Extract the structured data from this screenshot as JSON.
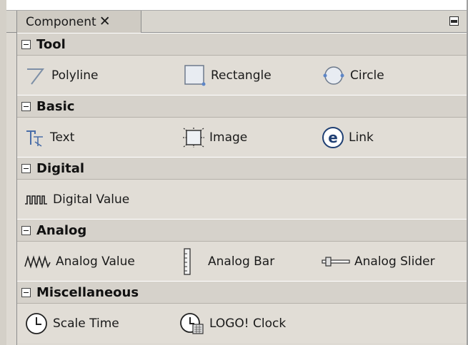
{
  "tab": {
    "label": "Component",
    "close_glyph": "✕"
  },
  "sections": [
    {
      "title": "Tool",
      "items": [
        {
          "label": "Polyline",
          "icon": "polyline-icon"
        },
        {
          "label": "Rectangle",
          "icon": "rectangle-icon"
        },
        {
          "label": "Circle",
          "icon": "circle-icon"
        }
      ]
    },
    {
      "title": "Basic",
      "items": [
        {
          "label": "Text",
          "icon": "text-icon"
        },
        {
          "label": "Image",
          "icon": "image-icon"
        },
        {
          "label": "Link",
          "icon": "link-icon",
          "icon_glyph": "e"
        }
      ]
    },
    {
      "title": "Digital",
      "items": [
        {
          "label": "Digital Value",
          "icon": "digital-value-icon"
        }
      ]
    },
    {
      "title": "Analog",
      "items": [
        {
          "label": "Analog Value",
          "icon": "analog-value-icon"
        },
        {
          "label": "Analog Bar",
          "icon": "analog-bar-icon"
        },
        {
          "label": "Analog Slider",
          "icon": "analog-slider-icon"
        }
      ]
    },
    {
      "title": "Miscellaneous",
      "items": [
        {
          "label": "Scale Time",
          "icon": "scale-time-icon"
        },
        {
          "label": "LOGO! Clock",
          "icon": "logo-clock-icon"
        }
      ]
    }
  ],
  "colors": {
    "panel_bg": "#e1ddd6",
    "header_bg": "#d6d2cb",
    "icon_blue": "#2b4f8c"
  }
}
